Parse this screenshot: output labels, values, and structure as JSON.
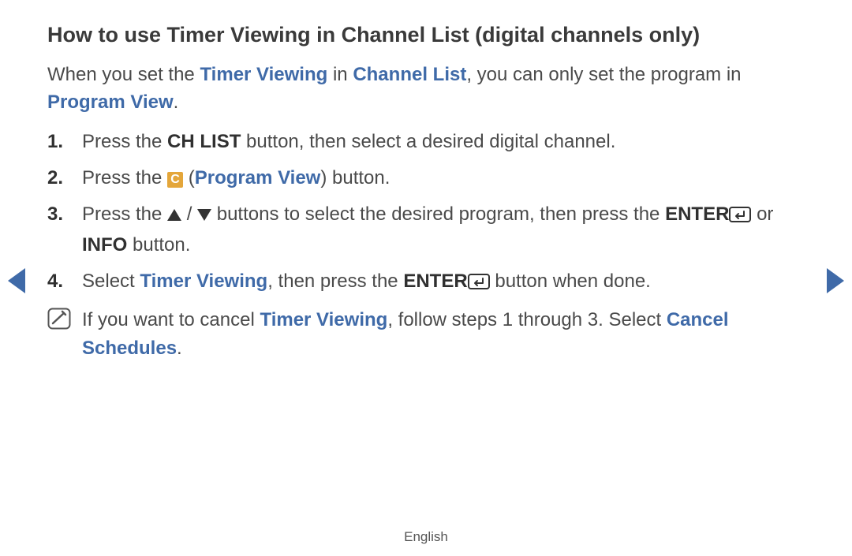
{
  "title": "How to use Timer Viewing in Channel List (digital channels only)",
  "intro": {
    "t1": "When you set the ",
    "k1": "Timer Viewing",
    "t2": " in ",
    "k2": "Channel List",
    "t3": ", you can only set the program in ",
    "k3": "Program View",
    "t4": "."
  },
  "steps": {
    "s1": {
      "num": "1.",
      "a": "Press the ",
      "b": "CH LIST",
      "c": " button, then select a desired digital channel."
    },
    "s2": {
      "num": "2.",
      "a": "Press the ",
      "badge": "C",
      "b": " (",
      "k": "Program View",
      "c": ") button."
    },
    "s3": {
      "num": "3.",
      "a": "Press the ",
      "slash": " / ",
      "b": " buttons to select the desired program, then press the ",
      "enter": "ENTER",
      "c": " or ",
      "info": "INFO",
      "d": " button."
    },
    "s4": {
      "num": "4.",
      "a": "Select ",
      "k": "Timer Viewing",
      "b": ", then press the ",
      "enter": "ENTER",
      "c": " button when done."
    }
  },
  "note": {
    "a": "If you want to cancel ",
    "k1": "Timer Viewing",
    "b": ", follow steps 1 through 3. Select ",
    "k2": "Cancel Schedules",
    "c": "."
  },
  "footer": {
    "language": "English"
  }
}
